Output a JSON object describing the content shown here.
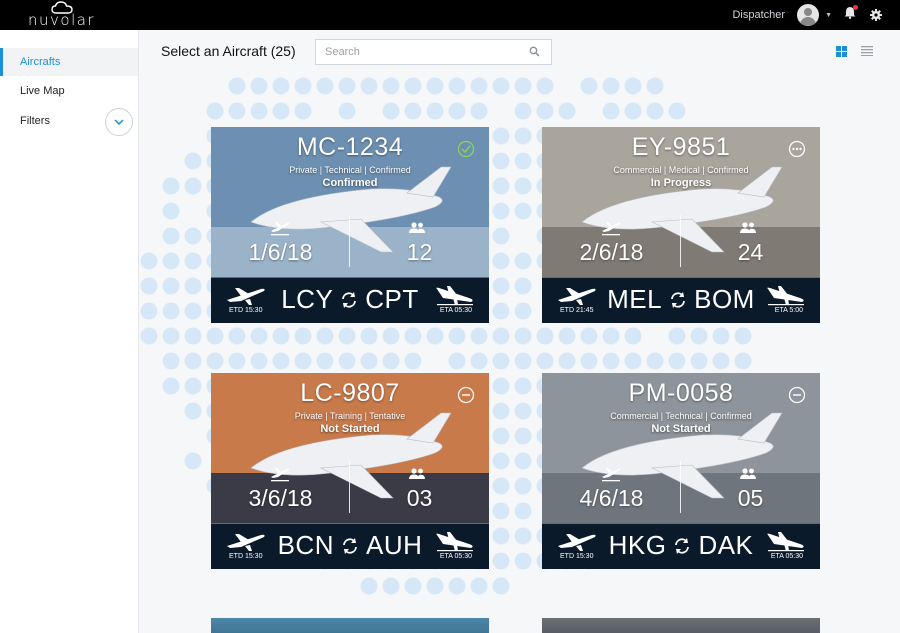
{
  "header": {
    "logo_text": "nuvolar",
    "user_role": "Dispatcher"
  },
  "sidebar": {
    "items": [
      {
        "label": "Aircrafts"
      },
      {
        "label": "Live Map"
      },
      {
        "label": "Filters"
      }
    ]
  },
  "main": {
    "title": "Select an Aircraft (25)",
    "search_placeholder": "Search"
  },
  "cards": [
    {
      "reg": "MC-1234",
      "tags": "Private | Technical | Confirmed",
      "status": "Confirmed",
      "state_icon": "check-circle-icon",
      "date": "1/6/18",
      "pax": "12",
      "from": "LCY",
      "to": "CPT",
      "etd": "ETD 15:30",
      "eta": "ETA 05:30"
    },
    {
      "reg": "EY-9851",
      "tags": "Commercial | Medical | Confirmed",
      "status": "In Progress",
      "state_icon": "more-circle-icon",
      "date": "2/6/18",
      "pax": "24",
      "from": "MEL",
      "to": "BOM",
      "etd": "ETD 21:45",
      "eta": "ETA 5:00"
    },
    {
      "reg": "LC-9807",
      "tags": "Private | Training | Tentative",
      "status": "Not Started",
      "state_icon": "minus-circle-icon",
      "date": "3/6/18",
      "pax": "03",
      "from": "BCN",
      "to": "AUH",
      "etd": "ETD 15:30",
      "eta": "ETA 05:30"
    },
    {
      "reg": "PM-0058",
      "tags": "Commercial | Technical | Confirmed",
      "status": "Not Started",
      "state_icon": "minus-circle-icon",
      "date": "4/6/18",
      "pax": "05",
      "from": "HKG",
      "to": "DAK",
      "etd": "ETD 15:30",
      "eta": "ETA 05:30"
    }
  ],
  "colors": {
    "accent": "#1d8fd8",
    "topbar": "#000000",
    "route_bar": "#0b1a2a",
    "dots": "#d6e8f7"
  }
}
